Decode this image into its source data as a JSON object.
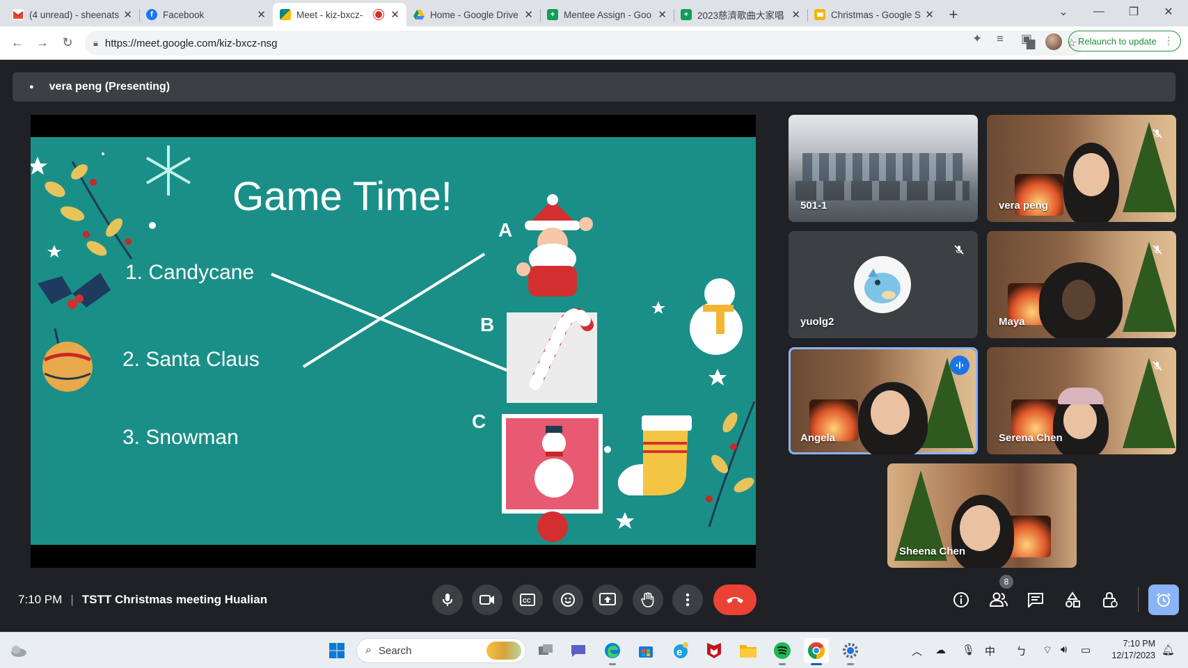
{
  "browser": {
    "tabs": [
      {
        "title": "(4 unread) - sheenats",
        "icon": "gmail-icon",
        "color": "#ffffff"
      },
      {
        "title": "Facebook",
        "icon": "facebook-icon",
        "color": "#1877f2"
      },
      {
        "title": "Meet - kiz-bxcz-",
        "icon": "meet-icon",
        "color": "#00897b",
        "active": true,
        "recording": true
      },
      {
        "title": "Home - Google Drive",
        "icon": "drive-icon",
        "color": "#fbbc04"
      },
      {
        "title": "Mentee Assign - Goo",
        "icon": "sheets-icon",
        "color": "#0f9d58"
      },
      {
        "title": "2023慈濟歌曲大家唱",
        "icon": "sheets-icon",
        "color": "#0f9d58"
      },
      {
        "title": "Christmas - Google S",
        "icon": "slides-icon",
        "color": "#f4b400"
      }
    ],
    "url": "https://meet.google.com/kiz-bxcz-nsg",
    "relaunch_label": "Relaunch to update"
  },
  "meet": {
    "presenting_label": "vera peng (Presenting)",
    "slide": {
      "title": "Game Time!",
      "items": [
        "1.   Candycane",
        "2. Santa Claus",
        "3. Snowman"
      ],
      "letters": [
        "A",
        "B",
        "C"
      ]
    },
    "participants": [
      {
        "name": "501-1",
        "muted": false,
        "scene": "classroom"
      },
      {
        "name": "vera peng",
        "muted": true,
        "scene": "christmas"
      },
      {
        "name": "yuolg2",
        "muted": true,
        "scene": "avatar"
      },
      {
        "name": "Maya",
        "muted": true,
        "scene": "christmas"
      },
      {
        "name": "Angela",
        "muted": false,
        "speaking": true,
        "scene": "christmas"
      },
      {
        "name": "Serena Chen",
        "muted": true,
        "scene": "christmas"
      },
      {
        "name": "Sheena Chen",
        "muted": false,
        "scene": "christmas"
      }
    ],
    "time": "7:10 PM",
    "meeting_name": "TSTT Christmas meeting Hualian",
    "participant_count": "8",
    "end_call_color": "#ea4335"
  },
  "taskbar": {
    "search_placeholder": "Search",
    "tray_ime": "中",
    "tray_ime2": "ㄅ",
    "clock_time": "7:10 PM",
    "clock_date": "12/17/2023"
  }
}
